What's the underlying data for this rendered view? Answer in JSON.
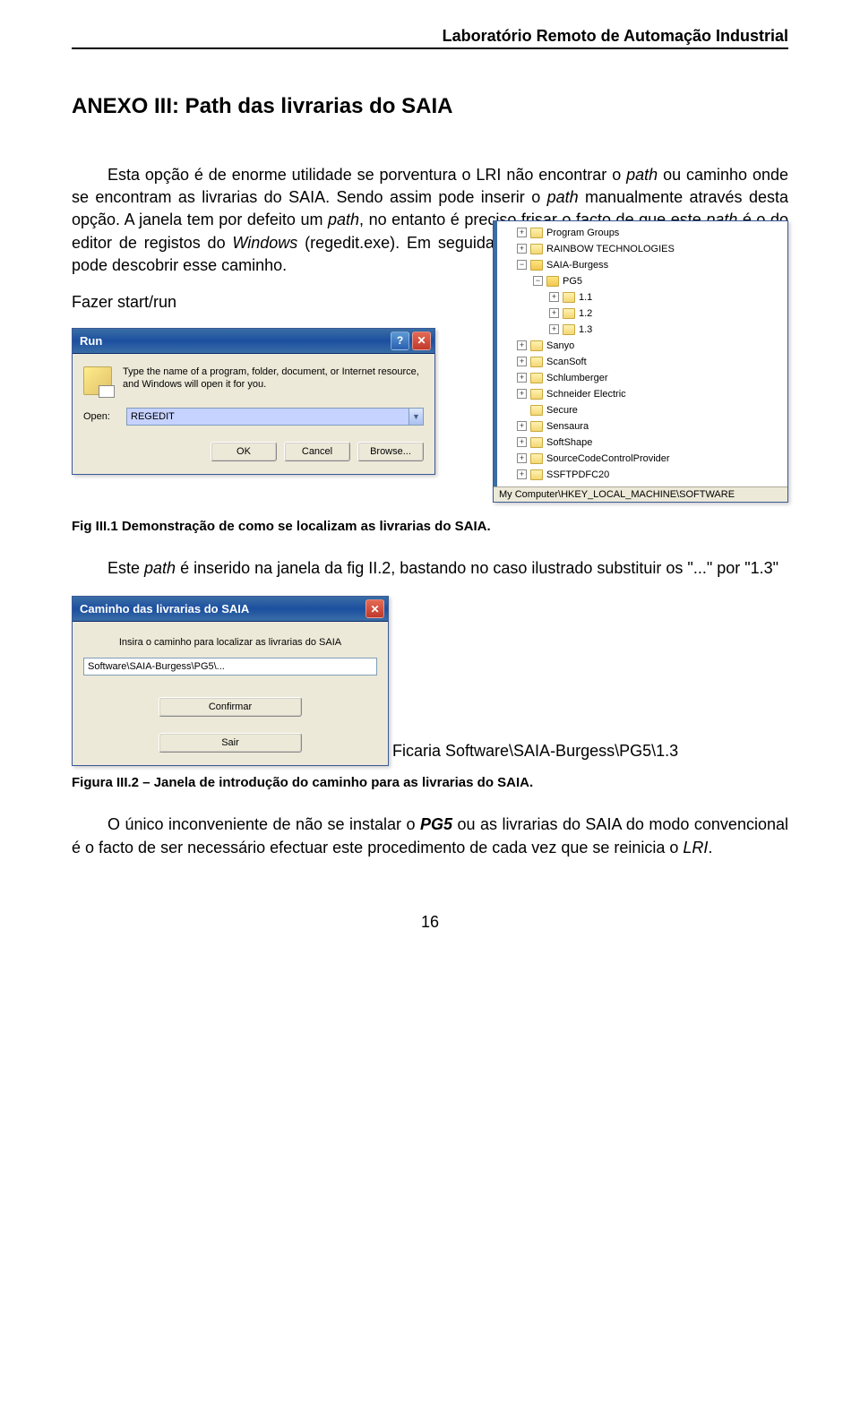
{
  "header": {
    "title": "Laboratório Remoto de Automação Industrial"
  },
  "page": {
    "number": "16"
  },
  "title": "ANEXO III: Path das livrarias do SAIA",
  "p1": {
    "a": "Esta opção é de enorme utilidade se porventura o LRI não encontrar o ",
    "b": "path",
    "c": " ou caminho onde se encontram as livrarias do SAIA. Sendo assim pode inserir o ",
    "d": "path",
    "e": " manualmente através desta opção. A janela tem por defeito um ",
    "f": "path",
    "g": ", no entanto é preciso frisar o facto de que este ",
    "h": "path",
    "i": " é o do editor de registos do ",
    "j": "Windows",
    "k": " (regedit.exe). Em seguida faz-se uma demonstração de como se pode descobrir esse caminho."
  },
  "start_run": "Fazer start/run",
  "run": {
    "title": "Run",
    "desc": "Type the name of a program, folder, document, or Internet resource, and Windows will open it for you.",
    "open_label": "Open:",
    "value": "REGEDIT",
    "ok": "OK",
    "cancel": "Cancel",
    "browse": "Browse..."
  },
  "registry": {
    "items": [
      {
        "label": "Program Groups",
        "indent": "ind1",
        "exp": "+",
        "open": false
      },
      {
        "label": "RAINBOW TECHNOLOGIES",
        "indent": "ind1",
        "exp": "+",
        "open": false
      },
      {
        "label": "SAIA-Burgess",
        "indent": "ind1",
        "exp": "−",
        "open": true
      },
      {
        "label": "PG5",
        "indent": "ind2",
        "exp": "−",
        "open": true
      },
      {
        "label": "1.1",
        "indent": "ind3",
        "exp": "+",
        "open": false
      },
      {
        "label": "1.2",
        "indent": "ind3",
        "exp": "+",
        "open": false
      },
      {
        "label": "1.3",
        "indent": "ind3",
        "exp": "+",
        "open": false
      },
      {
        "label": "Sanyo",
        "indent": "ind1",
        "exp": "+",
        "open": false
      },
      {
        "label": "ScanSoft",
        "indent": "ind1",
        "exp": "+",
        "open": false
      },
      {
        "label": "Schlumberger",
        "indent": "ind1",
        "exp": "+",
        "open": false
      },
      {
        "label": "Schneider Electric",
        "indent": "ind1",
        "exp": "+",
        "open": false
      },
      {
        "label": "Secure",
        "indent": "ind1",
        "exp": "",
        "open": false
      },
      {
        "label": "Sensaura",
        "indent": "ind1",
        "exp": "+",
        "open": false
      },
      {
        "label": "SoftShape",
        "indent": "ind1",
        "exp": "+",
        "open": false
      },
      {
        "label": "SourceCodeControlProvider",
        "indent": "ind1",
        "exp": "+",
        "open": false
      },
      {
        "label": "SSFTPDFC20",
        "indent": "ind1",
        "exp": "+",
        "open": false
      }
    ],
    "status": "My Computer\\HKEY_LOCAL_MACHINE\\SOFTWARE"
  },
  "caption1": "Fig III.1 Demonstração de como se localizam as livrarias do SAIA.",
  "p2": {
    "a": "Este ",
    "b": "path",
    "c": " é inserido na janela da fig II.2, bastando no caso ilustrado substituir os \"...\" por \"1.3\""
  },
  "caminho": {
    "title": "Caminho das livrarias do SAIA",
    "text": "Insira o caminho para localizar as livrarias do SAIA",
    "value": "Software\\SAIA-Burgess\\PG5\\...",
    "confirm": "Confirmar",
    "sair": "Sair"
  },
  "ficaria": "Ficaria Software\\SAIA-Burgess\\PG5\\1.3",
  "caption2": "Figura III.2 – Janela de introdução do caminho para as livrarias do SAIA.",
  "p3": {
    "a": "O único inconveniente de não se instalar o ",
    "b": "PG5",
    "c": " ou as livrarias do SAIA do modo convencional é o facto de ser necessário efectuar este procedimento de cada vez que se reinicia o ",
    "d": "LRI",
    "e": "."
  }
}
